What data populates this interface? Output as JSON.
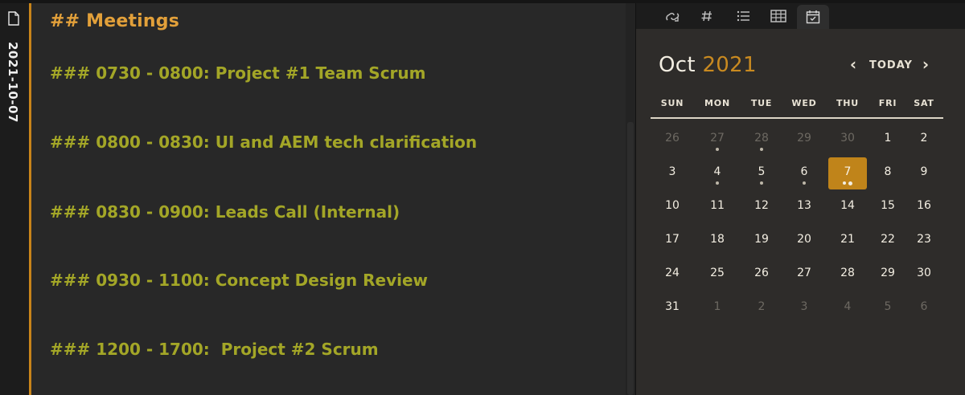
{
  "sidebar": {
    "note_title": "2021-10-07"
  },
  "editor": {
    "heading": "## Meetings",
    "meetings": [
      "### 0730 - 0800: Project #1 Team Scrum",
      "### 0800 - 0830: UI and AEM tech clarification",
      "### 0830 - 0900: Leads Call (Internal)",
      "### 0930 - 1100: Concept Design Review",
      "### 1200 - 1700:  Project #2 Scrum"
    ]
  },
  "right_panel": {
    "tabs": [
      {
        "icon": "backlinks-icon",
        "active": false
      },
      {
        "icon": "tag-hash-icon",
        "active": false
      },
      {
        "icon": "outline-list-icon",
        "active": false
      },
      {
        "icon": "table-icon",
        "active": false
      },
      {
        "icon": "calendar-check-icon",
        "active": true
      }
    ],
    "calendar": {
      "month": "Oct",
      "year": "2021",
      "today_label": "TODAY",
      "weekdays": [
        "SUN",
        "MON",
        "TUE",
        "WED",
        "THU",
        "FRI",
        "SAT"
      ],
      "weeks": [
        [
          {
            "d": "26",
            "muted": true,
            "dots": 0
          },
          {
            "d": "27",
            "muted": true,
            "dots": 1
          },
          {
            "d": "28",
            "muted": true,
            "dots": 1
          },
          {
            "d": "29",
            "muted": true,
            "dots": 0
          },
          {
            "d": "30",
            "muted": true,
            "dots": 0
          },
          {
            "d": "1",
            "muted": false,
            "dots": 0
          },
          {
            "d": "2",
            "muted": false,
            "dots": 0
          }
        ],
        [
          {
            "d": "3",
            "muted": false,
            "dots": 0
          },
          {
            "d": "4",
            "muted": false,
            "dots": 1
          },
          {
            "d": "5",
            "muted": false,
            "dots": 1
          },
          {
            "d": "6",
            "muted": false,
            "dots": 1
          },
          {
            "d": "7",
            "muted": false,
            "dots": 1,
            "today": true,
            "hollow": true
          },
          {
            "d": "8",
            "muted": false,
            "dots": 0
          },
          {
            "d": "9",
            "muted": false,
            "dots": 0
          }
        ],
        [
          {
            "d": "10",
            "muted": false,
            "dots": 0
          },
          {
            "d": "11",
            "muted": false,
            "dots": 0
          },
          {
            "d": "12",
            "muted": false,
            "dots": 0
          },
          {
            "d": "13",
            "muted": false,
            "dots": 0
          },
          {
            "d": "14",
            "muted": false,
            "dots": 0
          },
          {
            "d": "15",
            "muted": false,
            "dots": 0
          },
          {
            "d": "16",
            "muted": false,
            "dots": 0
          }
        ],
        [
          {
            "d": "17",
            "muted": false,
            "dots": 0
          },
          {
            "d": "18",
            "muted": false,
            "dots": 0
          },
          {
            "d": "19",
            "muted": false,
            "dots": 0
          },
          {
            "d": "20",
            "muted": false,
            "dots": 0
          },
          {
            "d": "21",
            "muted": false,
            "dots": 0
          },
          {
            "d": "22",
            "muted": false,
            "dots": 0
          },
          {
            "d": "23",
            "muted": false,
            "dots": 0
          }
        ],
        [
          {
            "d": "24",
            "muted": false,
            "dots": 0
          },
          {
            "d": "25",
            "muted": false,
            "dots": 0
          },
          {
            "d": "26",
            "muted": false,
            "dots": 0
          },
          {
            "d": "27",
            "muted": false,
            "dots": 0
          },
          {
            "d": "28",
            "muted": false,
            "dots": 0
          },
          {
            "d": "29",
            "muted": false,
            "dots": 0
          },
          {
            "d": "30",
            "muted": false,
            "dots": 0
          }
        ],
        [
          {
            "d": "31",
            "muted": false,
            "dots": 0
          },
          {
            "d": "1",
            "muted": true,
            "dots": 0
          },
          {
            "d": "2",
            "muted": true,
            "dots": 0
          },
          {
            "d": "3",
            "muted": true,
            "dots": 0
          },
          {
            "d": "4",
            "muted": true,
            "dots": 0
          },
          {
            "d": "5",
            "muted": true,
            "dots": 0
          },
          {
            "d": "6",
            "muted": true,
            "dots": 0
          }
        ]
      ]
    }
  },
  "colors": {
    "accent": "#c8841a",
    "heading2": "#e2a03a",
    "heading3": "#a3a627",
    "today_bg": "#c0841a"
  }
}
